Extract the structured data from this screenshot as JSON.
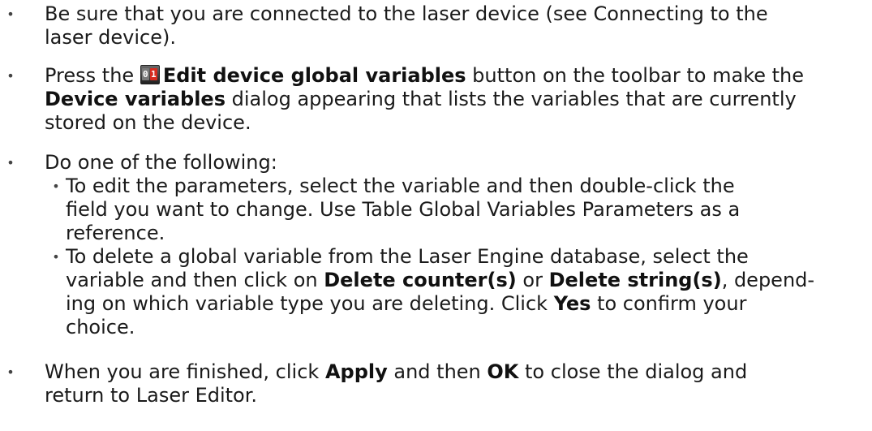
{
  "bullet_glyph": "•",
  "step1": {
    "line1": "Be sure that you are connected to the laser device (see Connecting to the",
    "line2": "laser device)."
  },
  "step2": {
    "t1": "Press the ",
    "icon_name": "edit-device-global-variables-icon",
    "icon_zero": "0",
    "icon_one": "1",
    "b1": "Edit device global variables",
    "t2": " button on the toolbar to make the",
    "b2": "Device variables",
    "t3": " dialog appearing that lists the variables that are currently",
    "t4": "stored on the device."
  },
  "step3": {
    "text": "Do one of the following:",
    "sub1": {
      "line1": "To edit the parameters, select the variable and then double-click the",
      "line2": "field you want to change. Use Table Global Variables Parameters as a",
      "line3": "reference."
    },
    "sub2": {
      "line1": "To delete a global variable from the Laser Engine database, select the",
      "t1": "variable and then click on ",
      "b1": "Delete counter(s)",
      "t2": " or ",
      "b2": "Delete string(s)",
      "t3": ", depend-",
      "t4": "ing on which variable type you are deleting. Click ",
      "b3": "Yes",
      "t5": " to confirm your",
      "line4": "choice."
    }
  },
  "step4": {
    "t1": "When you are finished, click ",
    "b1": "Apply",
    "t2": " and then ",
    "b2": "OK",
    "t3": " to close the dialog and",
    "line2": "return to Laser Editor."
  }
}
